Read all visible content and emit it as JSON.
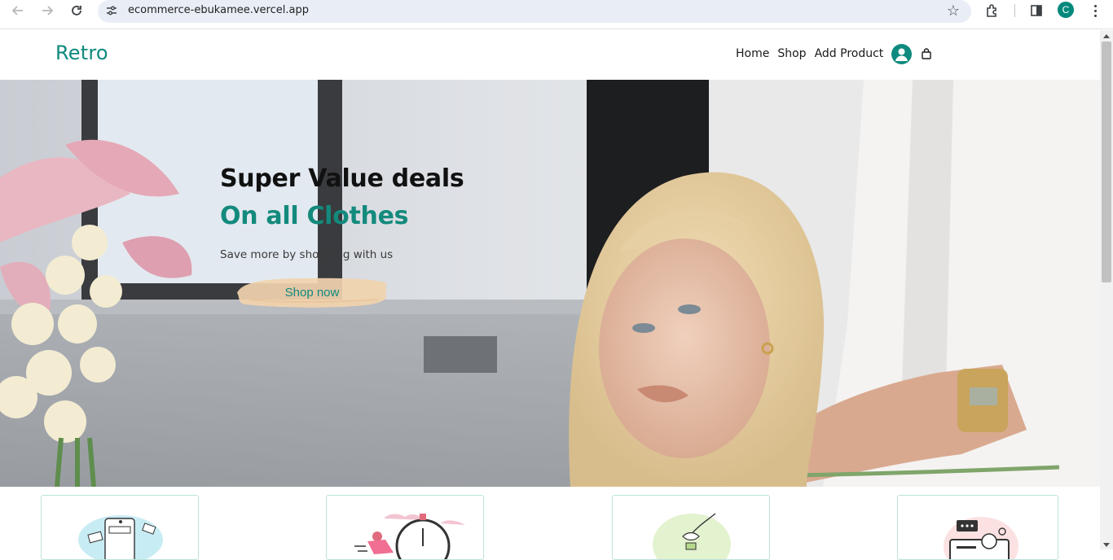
{
  "browser": {
    "url": "ecommerce-ebukamee.vercel.app",
    "profile_initial": "C",
    "icons": [
      "back-arrow-icon",
      "forward-arrow-icon",
      "reload-icon",
      "site-info-icon",
      "bookmark-star-icon",
      "extensions-icon",
      "side-panel-icon",
      "kebab-menu-icon"
    ]
  },
  "site": {
    "logo": "Retro",
    "nav": {
      "home": "Home",
      "shop": "Shop",
      "add_product": "Add Product"
    },
    "icons": [
      "user-avatar-icon",
      "shopping-bag-icon"
    ]
  },
  "hero": {
    "title": "Super Value deals",
    "subtitle": "On all Clothes",
    "text": "Save more by shopping with us",
    "button": "Shop now"
  },
  "features": [
    {
      "icon": "payment-phone-illustration"
    },
    {
      "icon": "fast-delivery-stopwatch-illustration"
    },
    {
      "icon": "save-money-hand-illustration"
    },
    {
      "icon": "customer-support-illustration"
    }
  ],
  "colors": {
    "accent": "#0f8a7e",
    "button_brush": "#f1d2ae",
    "omnibox": "#e9eef6"
  }
}
